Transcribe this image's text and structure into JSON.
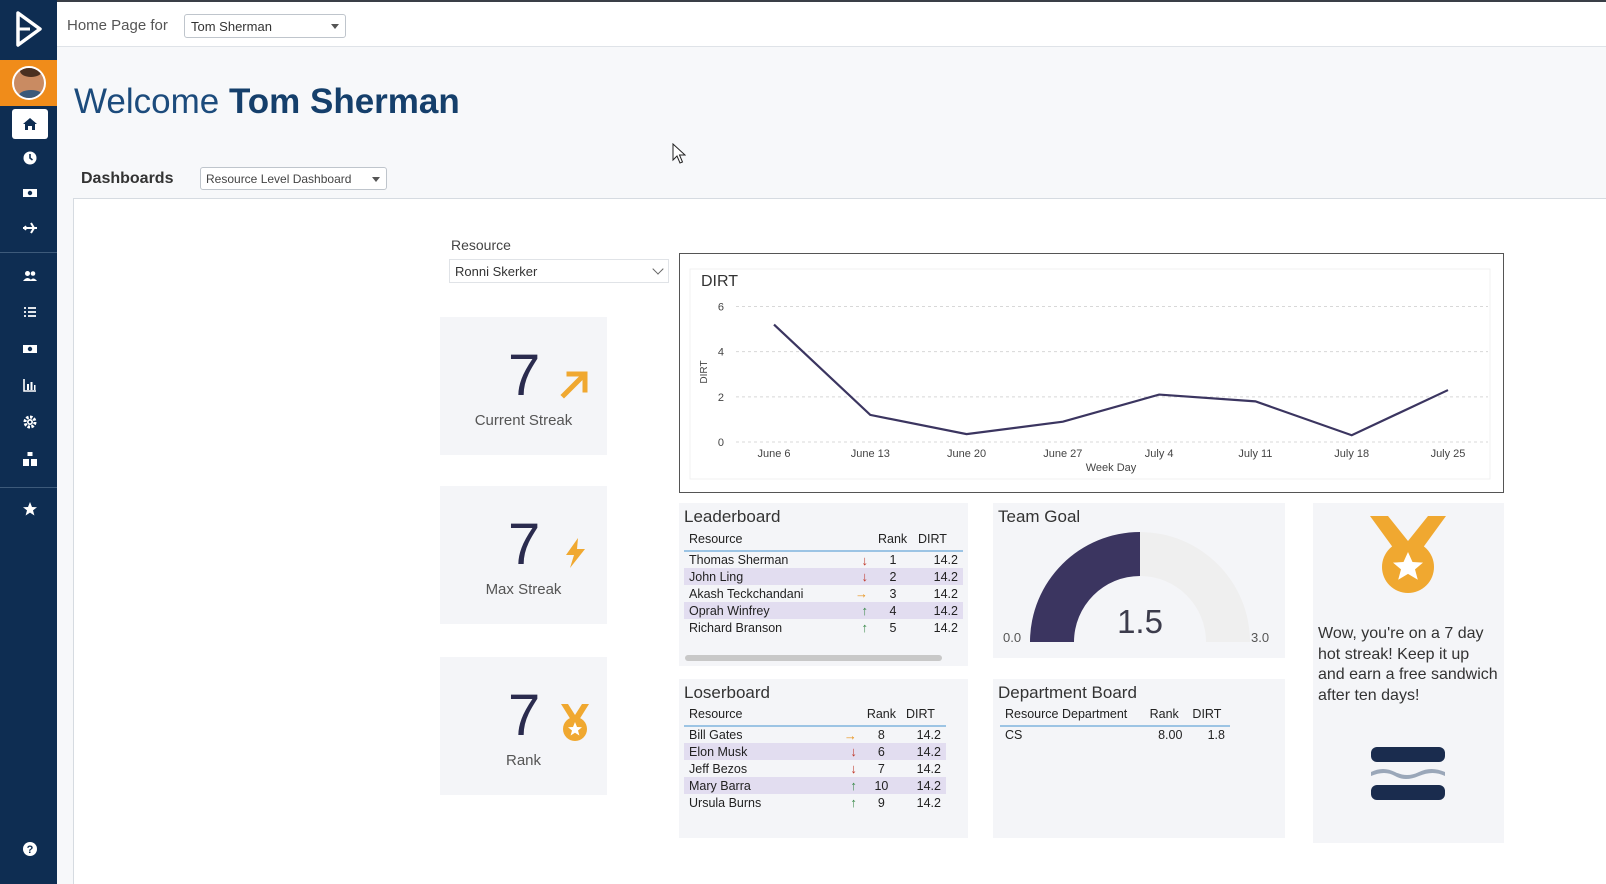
{
  "topbar": {
    "home_page_for": "Home Page for",
    "user_select": "Tom Sherman"
  },
  "welcome": {
    "prefix": "Welcome",
    "name": "Tom Sherman"
  },
  "dashboards": {
    "label": "Dashboards",
    "selected": "Resource Level Dashboard"
  },
  "resource": {
    "label": "Resource",
    "selected": "Ronni Skerker"
  },
  "stats": [
    {
      "value": "7",
      "label": "Current Streak",
      "icon": "arrow-up-right-icon"
    },
    {
      "value": "7",
      "label": "Max Streak",
      "icon": "lightning-icon"
    },
    {
      "value": "7",
      "label": "Rank",
      "icon": "medal-icon"
    }
  ],
  "chart_data": {
    "type": "line",
    "title": "DIRT",
    "xlabel": "Week Day",
    "ylabel": "DIRT",
    "categories": [
      "June 6",
      "June 13",
      "June 20",
      "June 27",
      "July 4",
      "July 11",
      "July 18",
      "July 25"
    ],
    "y_ticks": [
      "0",
      "2",
      "4",
      "6"
    ],
    "x": [
      0,
      1,
      2,
      3,
      4,
      5,
      6,
      7
    ],
    "values": [
      5.2,
      1.2,
      0.35,
      0.9,
      2.1,
      1.8,
      0.3,
      2.3
    ],
    "ylim": [
      0,
      6.2
    ],
    "grid": true,
    "line_color": "#3b3560"
  },
  "leaderboard": {
    "title": "Leaderboard",
    "headers": [
      "Resource",
      "Rank",
      "DIRT"
    ],
    "rows": [
      {
        "name": "Thomas Sherman",
        "trend": "down",
        "rank": "1",
        "dirt": "14.2"
      },
      {
        "name": "John Ling",
        "trend": "down",
        "rank": "2",
        "dirt": "14.2"
      },
      {
        "name": "Akash Teckchandani",
        "trend": "right",
        "rank": "3",
        "dirt": "14.2"
      },
      {
        "name": "Oprah Winfrey",
        "trend": "up",
        "rank": "4",
        "dirt": "14.2"
      },
      {
        "name": "Richard Branson",
        "trend": "up",
        "rank": "5",
        "dirt": "14.2"
      }
    ]
  },
  "loserboard": {
    "title": "Loserboard",
    "headers": [
      "Resource",
      "Rank",
      "DIRT"
    ],
    "rows": [
      {
        "name": "Bill Gates",
        "trend": "right",
        "rank": "8",
        "dirt": "14.2"
      },
      {
        "name": "Elon Musk",
        "trend": "down",
        "rank": "6",
        "dirt": "14.2"
      },
      {
        "name": "Jeff Bezos",
        "trend": "down",
        "rank": "7",
        "dirt": "14.2"
      },
      {
        "name": "Mary Barra",
        "trend": "up",
        "rank": "10",
        "dirt": "14.2"
      },
      {
        "name": "Ursula Burns",
        "trend": "up",
        "rank": "9",
        "dirt": "14.2"
      }
    ]
  },
  "team_goal": {
    "title": "Team Goal",
    "min": "0.0",
    "max": "3.0",
    "value": "1.5",
    "fraction": 0.5
  },
  "department_board": {
    "title": "Department Board",
    "headers": [
      "Resource Department",
      "Rank",
      "DIRT"
    ],
    "rows": [
      {
        "dept": "CS",
        "rank": "8.00",
        "dirt": "1.8"
      }
    ]
  },
  "streak_card": {
    "message": "Wow, you're on a 7 day hot streak! Keep it up and earn a free sandwich after ten days!"
  },
  "colors": {
    "navy": "#0e2d52",
    "accent_orange": "#f08c1a",
    "gold": "#f0a830",
    "down_red": "#c0392b",
    "up_green": "#3a8a4a",
    "right_orange": "#e8921a",
    "gauge_fill": "#3b3560",
    "gauge_track": "#efefef"
  }
}
